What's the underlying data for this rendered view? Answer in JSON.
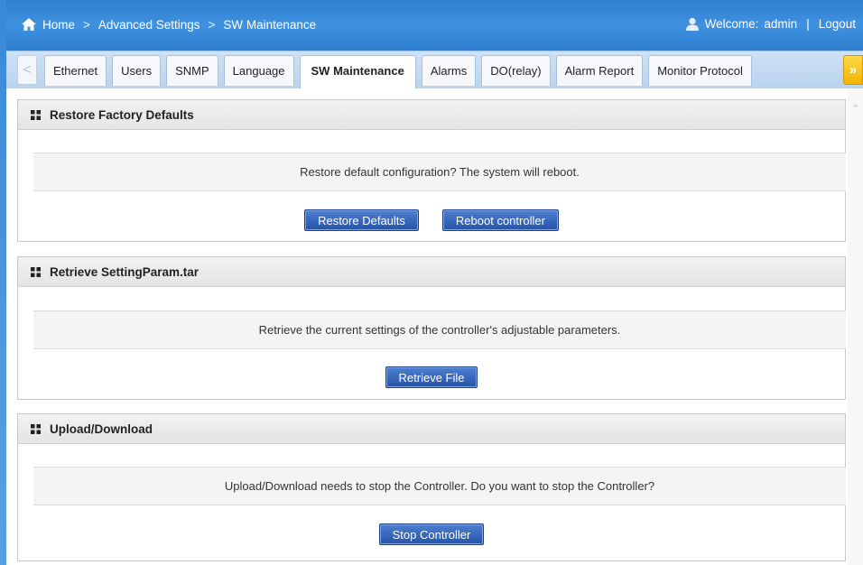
{
  "header": {
    "breadcrumb": [
      "Home",
      "Advanced Settings",
      "SW Maintenance"
    ],
    "separator": ">",
    "welcome_label": "Welcome:",
    "username": "admin",
    "divider": "|",
    "logout_label": "Logout",
    "icons": [
      "home-icon",
      "user-icon"
    ]
  },
  "tabs": {
    "prev": "<",
    "next": "»",
    "items": [
      "Ethernet",
      "Users",
      "SNMP",
      "Language",
      "SW Maintenance",
      "Alarms",
      "DO(relay)",
      "Alarm Report",
      "Monitor Protocol"
    ],
    "active": "SW Maintenance"
  },
  "panels": {
    "restore": {
      "title": "Restore Factory Defaults",
      "message": "Restore default configuration? The system will reboot.",
      "buttons": [
        "Restore Defaults",
        "Reboot controller"
      ]
    },
    "retrieve": {
      "title": "Retrieve SettingParam.tar",
      "message": "Retrieve the current settings of the controller's adjustable parameters.",
      "buttons": [
        "Retrieve File"
      ]
    },
    "upload": {
      "title": "Upload/Download",
      "message": "Upload/Download needs to stop the Controller. Do you want to stop the Controller?",
      "buttons": [
        "Stop Controller"
      ]
    }
  },
  "colors": {
    "header_blue": "#3489d9",
    "button_blue": "#2f5fb3",
    "tab_next_yellow": "#f5c000"
  }
}
